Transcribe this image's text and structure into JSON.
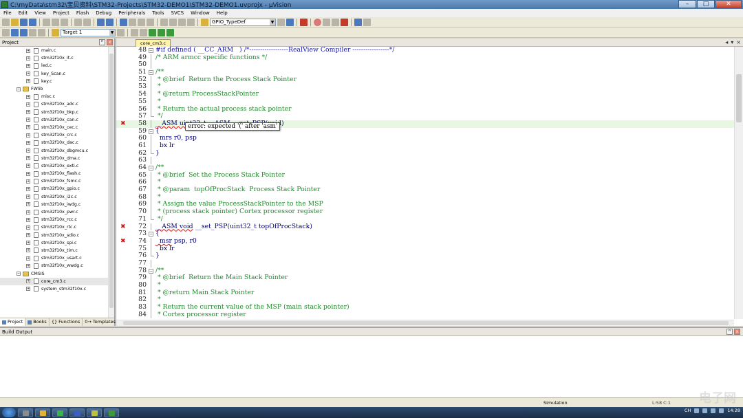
{
  "window": {
    "title": "C:\\myData\\stm32\\宝贝资料\\STM32-Projects\\STM32-DEMO1\\STM32-DEMO1.uvprojx - µVision",
    "min": "–",
    "max": "□",
    "close": "✕"
  },
  "menu": [
    "File",
    "Edit",
    "View",
    "Project",
    "Flash",
    "Debug",
    "Peripherals",
    "Tools",
    "SVCS",
    "Window",
    "Help"
  ],
  "toolbar": {
    "find_combo": "GPIO_TypeDef",
    "target_combo": "Target 1"
  },
  "project_pane": {
    "title": "Project",
    "tree": [
      {
        "label": "main.c",
        "type": "file",
        "indent": 2
      },
      {
        "label": "stm32f10x_it.c",
        "type": "file",
        "indent": 2
      },
      {
        "label": "led.c",
        "type": "file",
        "indent": 2
      },
      {
        "label": "key_Scan.c",
        "type": "file",
        "indent": 2
      },
      {
        "label": "key.c",
        "type": "file",
        "indent": 2
      },
      {
        "label": "FWlib",
        "type": "folder",
        "indent": 1
      },
      {
        "label": "misc.c",
        "type": "file",
        "indent": 2
      },
      {
        "label": "stm32f10x_adc.c",
        "type": "file",
        "indent": 2
      },
      {
        "label": "stm32f10x_bkp.c",
        "type": "file",
        "indent": 2
      },
      {
        "label": "stm32f10x_can.c",
        "type": "file",
        "indent": 2
      },
      {
        "label": "stm32f10x_cec.c",
        "type": "file",
        "indent": 2
      },
      {
        "label": "stm32f10x_crc.c",
        "type": "file",
        "indent": 2
      },
      {
        "label": "stm32f10x_dac.c",
        "type": "file",
        "indent": 2
      },
      {
        "label": "stm32f10x_dbgmcu.c",
        "type": "file",
        "indent": 2
      },
      {
        "label": "stm32f10x_dma.c",
        "type": "file",
        "indent": 2
      },
      {
        "label": "stm32f10x_exti.c",
        "type": "file",
        "indent": 2
      },
      {
        "label": "stm32f10x_flash.c",
        "type": "file",
        "indent": 2
      },
      {
        "label": "stm32f10x_fsmc.c",
        "type": "file",
        "indent": 2
      },
      {
        "label": "stm32f10x_gpio.c",
        "type": "file",
        "indent": 2
      },
      {
        "label": "stm32f10x_i2c.c",
        "type": "file",
        "indent": 2
      },
      {
        "label": "stm32f10x_iwdg.c",
        "type": "file",
        "indent": 2
      },
      {
        "label": "stm32f10x_pwr.c",
        "type": "file",
        "indent": 2
      },
      {
        "label": "stm32f10x_rcc.c",
        "type": "file",
        "indent": 2
      },
      {
        "label": "stm32f10x_rtc.c",
        "type": "file",
        "indent": 2
      },
      {
        "label": "stm32f10x_sdio.c",
        "type": "file",
        "indent": 2
      },
      {
        "label": "stm32f10x_spi.c",
        "type": "file",
        "indent": 2
      },
      {
        "label": "stm32f10x_tim.c",
        "type": "file",
        "indent": 2
      },
      {
        "label": "stm32f10x_usart.c",
        "type": "file",
        "indent": 2
      },
      {
        "label": "stm32f10x_wwdg.c",
        "type": "file",
        "indent": 2
      },
      {
        "label": "CMSIS",
        "type": "folder",
        "indent": 1
      },
      {
        "label": "core_cm3.c",
        "type": "file",
        "indent": 2,
        "selected": true
      },
      {
        "label": "system_stm32f10x.c",
        "type": "file",
        "indent": 2
      }
    ],
    "tabs": [
      "Project",
      "Books",
      "{} Functions",
      "0→ Templates"
    ]
  },
  "editor": {
    "file_tab": "core_cm3.c",
    "tooltip": "error: expected '(' after 'asm'",
    "lines": [
      {
        "n": "48",
        "t": "#if defined ( __CC_ARM   ) /*------------------RealView Compiler -----------------*/",
        "k": "pre",
        "fold": "minus"
      },
      {
        "n": "49",
        "t": "/* ARM armcc specific functions */",
        "k": "comment",
        "fold": "bar"
      },
      {
        "n": "50",
        "t": "",
        "k": "code",
        "fold": "bar"
      },
      {
        "n": "51",
        "t": "/**",
        "k": "comment",
        "fold": "minus"
      },
      {
        "n": "52",
        "t": " * @brief  Return the Process Stack Pointer",
        "k": "comment",
        "fold": "bar"
      },
      {
        "n": "53",
        "t": " *",
        "k": "comment",
        "fold": "bar"
      },
      {
        "n": "54",
        "t": " * @return ProcessStackPointer",
        "k": "comment",
        "fold": "bar"
      },
      {
        "n": "55",
        "t": " *",
        "k": "comment",
        "fold": "bar"
      },
      {
        "n": "56",
        "t": " * Return the actual process stack pointer",
        "k": "comment",
        "fold": "bar"
      },
      {
        "n": "57",
        "t": " */",
        "k": "comment",
        "fold": "end"
      },
      {
        "n": "58",
        "t": "__ASM uint32_t __ASM __get_PSP(void)",
        "k": "code",
        "fold": "bar",
        "err": true,
        "hl": true,
        "squig": "__ASM uint32_t __ASM"
      },
      {
        "n": "59",
        "t": "{",
        "k": "code",
        "fold": "minus"
      },
      {
        "n": "60",
        "t": "  mrs r0, psp",
        "k": "code",
        "fold": "bar"
      },
      {
        "n": "61",
        "t": "  bx lr",
        "k": "code",
        "fold": "bar"
      },
      {
        "n": "62",
        "t": "}",
        "k": "code",
        "fold": "end"
      },
      {
        "n": "63",
        "t": "",
        "k": "code",
        "fold": "bar"
      },
      {
        "n": "64",
        "t": "/**",
        "k": "comment",
        "fold": "minus"
      },
      {
        "n": "65",
        "t": " * @brief  Set the Process Stack Pointer",
        "k": "comment",
        "fold": "bar"
      },
      {
        "n": "66",
        "t": " *",
        "k": "comment",
        "fold": "bar"
      },
      {
        "n": "67",
        "t": " * @param  topOfProcStack  Process Stack Pointer",
        "k": "comment",
        "fold": "bar"
      },
      {
        "n": "68",
        "t": " *",
        "k": "comment",
        "fold": "bar"
      },
      {
        "n": "69",
        "t": " * Assign the value ProcessStackPointer to the MSP",
        "k": "comment",
        "fold": "bar"
      },
      {
        "n": "70",
        "t": " * (process stack pointer) Cortex processor register",
        "k": "comment",
        "fold": "bar"
      },
      {
        "n": "71",
        "t": " */",
        "k": "comment",
        "fold": "end"
      },
      {
        "n": "72",
        "t": "__ASM void __set_PSP(uint32_t topOfProcStack)",
        "k": "code",
        "fold": "bar",
        "err": true,
        "squig": "__ASM void"
      },
      {
        "n": "73",
        "t": "{",
        "k": "code",
        "fold": "minus"
      },
      {
        "n": "74",
        "t": "  msr psp, r0",
        "k": "code",
        "fold": "bar",
        "err": true,
        "squig": "  msr"
      },
      {
        "n": "75",
        "t": "  bx lr",
        "k": "code",
        "fold": "bar"
      },
      {
        "n": "76",
        "t": "}",
        "k": "code",
        "fold": "end"
      },
      {
        "n": "77",
        "t": "",
        "k": "code",
        "fold": "bar"
      },
      {
        "n": "78",
        "t": "/**",
        "k": "comment",
        "fold": "minus"
      },
      {
        "n": "79",
        "t": " * @brief  Return the Main Stack Pointer",
        "k": "comment",
        "fold": "bar"
      },
      {
        "n": "80",
        "t": " *",
        "k": "comment",
        "fold": "bar"
      },
      {
        "n": "81",
        "t": " * @return Main Stack Pointer",
        "k": "comment",
        "fold": "bar"
      },
      {
        "n": "82",
        "t": " *",
        "k": "comment",
        "fold": "bar"
      },
      {
        "n": "83",
        "t": " * Return the current value of the MSP (main stack pointer)",
        "k": "comment",
        "fold": "bar"
      },
      {
        "n": "84",
        "t": " * Cortex processor register",
        "k": "comment",
        "fold": "bar"
      }
    ]
  },
  "build_output": {
    "title": "Build Output",
    "text": ""
  },
  "status": {
    "mode": "Simulation",
    "position": "L:58 C:1",
    "watermark": "电子网"
  },
  "taskbar": {
    "lang": "CH",
    "time": "14:28"
  }
}
